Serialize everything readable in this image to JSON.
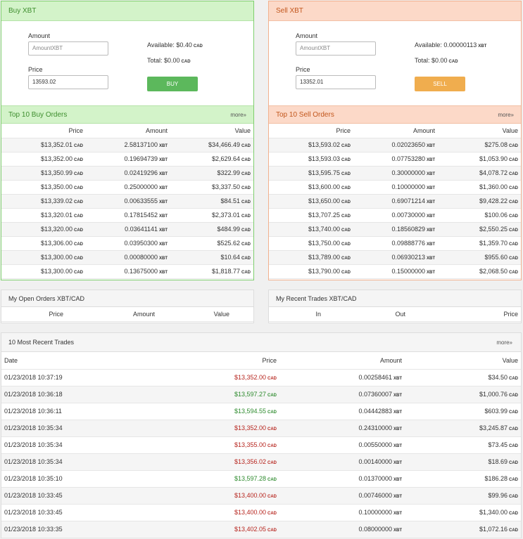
{
  "buy": {
    "title": "Buy XBT",
    "amount_label": "Amount",
    "amount_placeholder": "AmountXBT",
    "price_label": "Price",
    "price_value": "13593.02",
    "available": "Available: $0.40",
    "available_cur": "CAD",
    "total": "Total: $0.00",
    "total_cur": "CAD",
    "button": "BUY"
  },
  "sell": {
    "title": "Sell XBT",
    "amount_label": "Amount",
    "amount_placeholder": "AmountXBT",
    "price_label": "Price",
    "price_value": "13352.01",
    "available": "Available: 0.00000113",
    "available_cur": "XBT",
    "total": "Total: $0.00",
    "total_cur": "CAD",
    "button": "SELL"
  },
  "buy_orders": {
    "title": "Top 10 Buy Orders",
    "more": "more»",
    "columns": [
      "Price",
      "Amount",
      "Value"
    ],
    "rows": [
      [
        "$13,352.01",
        "2.58137100",
        "$34,466.49"
      ],
      [
        "$13,352.00",
        "0.19694739",
        "$2,629.64"
      ],
      [
        "$13,350.99",
        "0.02419296",
        "$322.99"
      ],
      [
        "$13,350.00",
        "0.25000000",
        "$3,337.50"
      ],
      [
        "$13,339.02",
        "0.00633555",
        "$84.51"
      ],
      [
        "$13,320.01",
        "0.17815452",
        "$2,373.01"
      ],
      [
        "$13,320.00",
        "0.03641141",
        "$484.99"
      ],
      [
        "$13,306.00",
        "0.03950300",
        "$525.62"
      ],
      [
        "$13,300.00",
        "0.00080000",
        "$10.64"
      ],
      [
        "$13,300.00",
        "0.13675000",
        "$1,818.77"
      ]
    ]
  },
  "sell_orders": {
    "title": "Top 10 Sell Orders",
    "more": "more»",
    "columns": [
      "Price",
      "Amount",
      "Value"
    ],
    "rows": [
      [
        "$13,593.02",
        "0.02023650",
        "$275.08"
      ],
      [
        "$13,593.03",
        "0.07753280",
        "$1,053.90"
      ],
      [
        "$13,595.75",
        "0.30000000",
        "$4,078.72"
      ],
      [
        "$13,600.00",
        "0.10000000",
        "$1,360.00"
      ],
      [
        "$13,650.00",
        "0.69071214",
        "$9,428.22"
      ],
      [
        "$13,707.25",
        "0.00730000",
        "$100.06"
      ],
      [
        "$13,740.00",
        "0.18560829",
        "$2,550.25"
      ],
      [
        "$13,750.00",
        "0.09888776",
        "$1,359.70"
      ],
      [
        "$13,789.00",
        "0.06930213",
        "$955.60"
      ],
      [
        "$13,790.00",
        "0.15000000",
        "$2,068.50"
      ]
    ]
  },
  "currency": {
    "cad": "CAD",
    "xbt": "XBT"
  },
  "open_orders": {
    "title": "My Open Orders XBT/CAD",
    "columns": [
      "Price",
      "Amount",
      "Value"
    ]
  },
  "recent_mine": {
    "title": "My Recent Trades XBT/CAD",
    "columns": [
      "In",
      "Out",
      "Price"
    ]
  },
  "recent_trades": {
    "title": "10 Most Recent Trades",
    "more": "more»",
    "columns": [
      "Date",
      "Price",
      "Amount",
      "Value"
    ],
    "rows": [
      {
        "date": "01/23/2018 10:37:19",
        "price": "$13,352.00",
        "dir": "down",
        "amount": "0.00258461",
        "value": "$34.50"
      },
      {
        "date": "01/23/2018 10:36:18",
        "price": "$13,597.27",
        "dir": "up",
        "amount": "0.07360007",
        "value": "$1,000.76"
      },
      {
        "date": "01/23/2018 10:36:11",
        "price": "$13,594.55",
        "dir": "up",
        "amount": "0.04442883",
        "value": "$603.99"
      },
      {
        "date": "01/23/2018 10:35:34",
        "price": "$13,352.00",
        "dir": "down",
        "amount": "0.24310000",
        "value": "$3,245.87"
      },
      {
        "date": "01/23/2018 10:35:34",
        "price": "$13,355.00",
        "dir": "down",
        "amount": "0.00550000",
        "value": "$73.45"
      },
      {
        "date": "01/23/2018 10:35:34",
        "price": "$13,356.02",
        "dir": "down",
        "amount": "0.00140000",
        "value": "$18.69"
      },
      {
        "date": "01/23/2018 10:35:10",
        "price": "$13,597.28",
        "dir": "up",
        "amount": "0.01370000",
        "value": "$186.28"
      },
      {
        "date": "01/23/2018 10:33:45",
        "price": "$13,400.00",
        "dir": "down",
        "amount": "0.00746000",
        "value": "$99.96"
      },
      {
        "date": "01/23/2018 10:33:45",
        "price": "$13,400.00",
        "dir": "down",
        "amount": "0.10000000",
        "value": "$1,340.00"
      },
      {
        "date": "01/23/2018 10:33:35",
        "price": "$13,402.05",
        "dir": "down",
        "amount": "0.08000000",
        "value": "$1,072.16"
      }
    ]
  }
}
